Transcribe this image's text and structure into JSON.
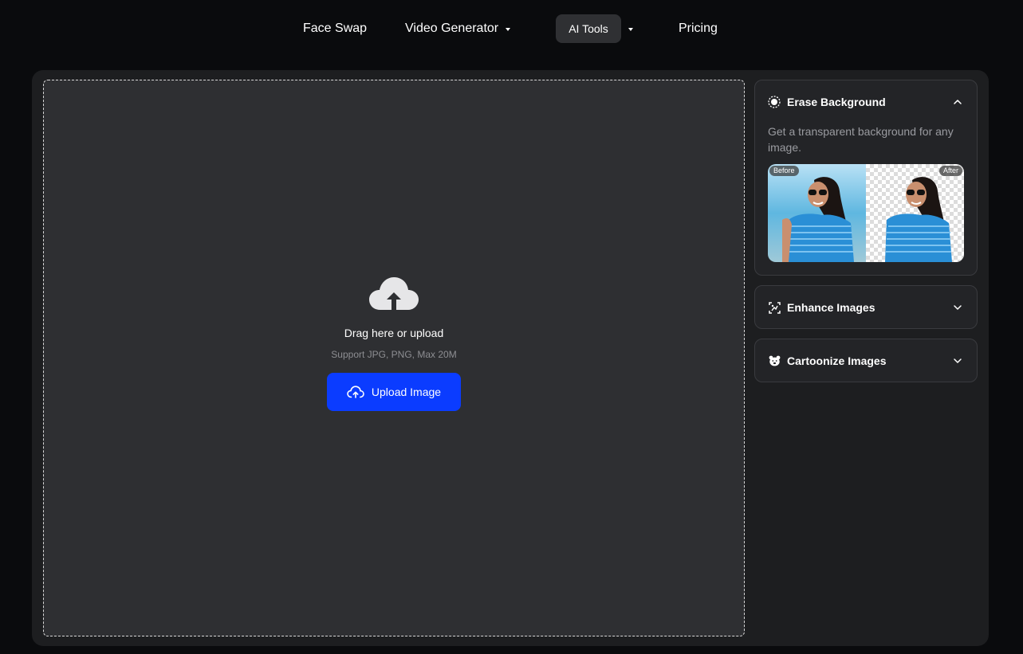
{
  "nav": {
    "items": [
      {
        "label": "Face Swap"
      },
      {
        "label": "Video Generator"
      },
      {
        "label": "AI Tools"
      },
      {
        "label": "Pricing"
      }
    ]
  },
  "upload": {
    "drag_text": "Drag here or upload",
    "support_text": "Support JPG, PNG, Max 20M",
    "button_label": "Upload Image"
  },
  "tools": [
    {
      "title": "Erase Background",
      "description": "Get a transparent background for any image.",
      "expanded": true,
      "before_label": "Before",
      "after_label": "After",
      "icon": "erase-background-icon"
    },
    {
      "title": "Enhance Images",
      "expanded": false,
      "icon": "enhance-icon"
    },
    {
      "title": "Cartoonize Images",
      "expanded": false,
      "icon": "cartoon-bear-icon"
    }
  ],
  "colors": {
    "accent": "#0b3cff",
    "background": "#0a0b0d",
    "panel": "#1d1e20",
    "dropzone": "#2e2f32"
  }
}
